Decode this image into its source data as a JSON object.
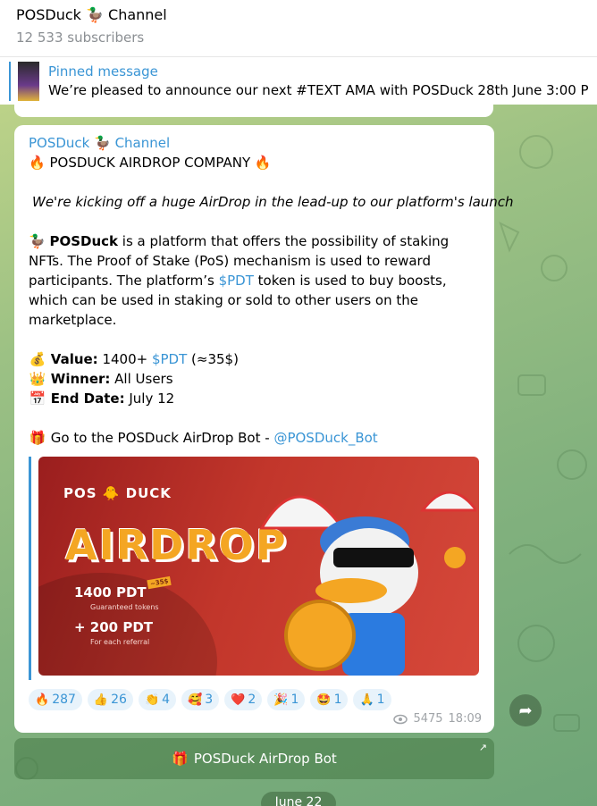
{
  "header": {
    "title": "POSDuck 🦆 Channel",
    "subscribers": "12 533 subscribers"
  },
  "pinned": {
    "label": "Pinned message",
    "text": "We’re pleased to announce our next #TEXT AMA with POSDuck 28th June 3:00 P",
    "thumb_text": "MA"
  },
  "post": {
    "author": "POSDuck 🦆 Channel",
    "headline": "POSDUCK AIRDROP COMPANY",
    "fire": "🔥",
    "intro": "We're kicking off a huge AirDrop in the lead-up to our platform's launch",
    "duck": "🦆",
    "para_bold": "POSDuck",
    "para_lines": [
      " is a platform that offers the possibility of staking",
      "NFTs. The Proof of Stake (PoS) mechanism is used to reward",
      "participants. The platform’s ",
      " token is used to buy boosts,",
      "which can be used in staking or sold to other users on the",
      "marketplace."
    ],
    "token": "$PDT",
    "value_icon": "💰",
    "value_label": "Value:",
    "value_pre": " 1400+ ",
    "value_post": " (≈35$)",
    "winner_icon": "👑",
    "winner_label": "Winner:",
    "winner_value": " All Users",
    "end_icon": "📅",
    "end_label": "End Date:",
    "end_value": " July 12",
    "gift": "🎁",
    "goto": "Go to the POSDuck AirDrop Bot",
    "goto_sep": " - ",
    "bot_handle": "@POSDuck_Bot",
    "views": "5475",
    "time": "18:09"
  },
  "banner": {
    "brand": "POS 🐥 DUCK",
    "airdrop": "AIRDROP",
    "prize1": "1400 PDT",
    "prize1_sub": "Guaranteed tokens",
    "prize2": "+ 200 PDT",
    "prize2_sub": "For each referral",
    "tag": "~35$"
  },
  "reactions": [
    {
      "emoji": "🔥",
      "count": "287"
    },
    {
      "emoji": "👍",
      "count": "26"
    },
    {
      "emoji": "👏",
      "count": "4"
    },
    {
      "emoji": "🥰",
      "count": "3"
    },
    {
      "emoji": "❤️",
      "count": "2"
    },
    {
      "emoji": "🎉",
      "count": "1"
    },
    {
      "emoji": "🤩",
      "count": "1"
    },
    {
      "emoji": "🙏",
      "count": "1"
    }
  ],
  "bot_button": {
    "icon": "🎁",
    "label": "POSDuck AirDrop Bot"
  },
  "date_pill": "June 22",
  "colors": {
    "accent": "#3a95d5",
    "bubble": "#ffffff"
  }
}
